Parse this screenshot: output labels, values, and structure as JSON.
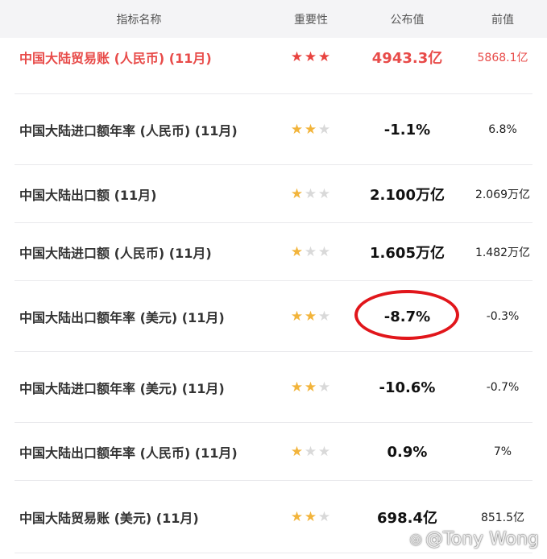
{
  "header": {
    "name": "指标名称",
    "importance": "重要性",
    "published": "公布值",
    "previous": "前值"
  },
  "rows": [
    {
      "name": "中国大陆贸易账 (人民币) (11月)",
      "importance": 3,
      "value": "4943.3亿",
      "previous": "5868.1亿"
    },
    {
      "name": "中国大陆进口额年率 (人民币) (11月)",
      "importance": 2,
      "value": "-1.1%",
      "previous": "6.8%"
    },
    {
      "name": "中国大陆出口额 (11月)",
      "importance": 1,
      "value": "2.100万亿",
      "previous": "2.069万亿"
    },
    {
      "name": "中国大陆进口额 (人民币) (11月)",
      "importance": 1,
      "value": "1.605万亿",
      "previous": "1.482万亿"
    },
    {
      "name": "中国大陆出口额年率 (美元) (11月)",
      "importance": 2,
      "value": "-8.7%",
      "previous": "-0.3%"
    },
    {
      "name": "中国大陆进口额年率 (美元) (11月)",
      "importance": 2,
      "value": "-10.6%",
      "previous": "-0.7%"
    },
    {
      "name": "中国大陆出口额年率 (人民币) (11月)",
      "importance": 1,
      "value": "0.9%",
      "previous": "7%"
    },
    {
      "name": "中国大陆贸易账 (美元) (11月)",
      "importance": 2,
      "value": "698.4亿",
      "previous": "851.5亿"
    }
  ],
  "watermark": "@Tony Wong",
  "colors": {
    "highlight": "#e84b49",
    "star_gold": "#f2b43b",
    "star_red": "#e8433f",
    "circle": "#e1161b"
  }
}
